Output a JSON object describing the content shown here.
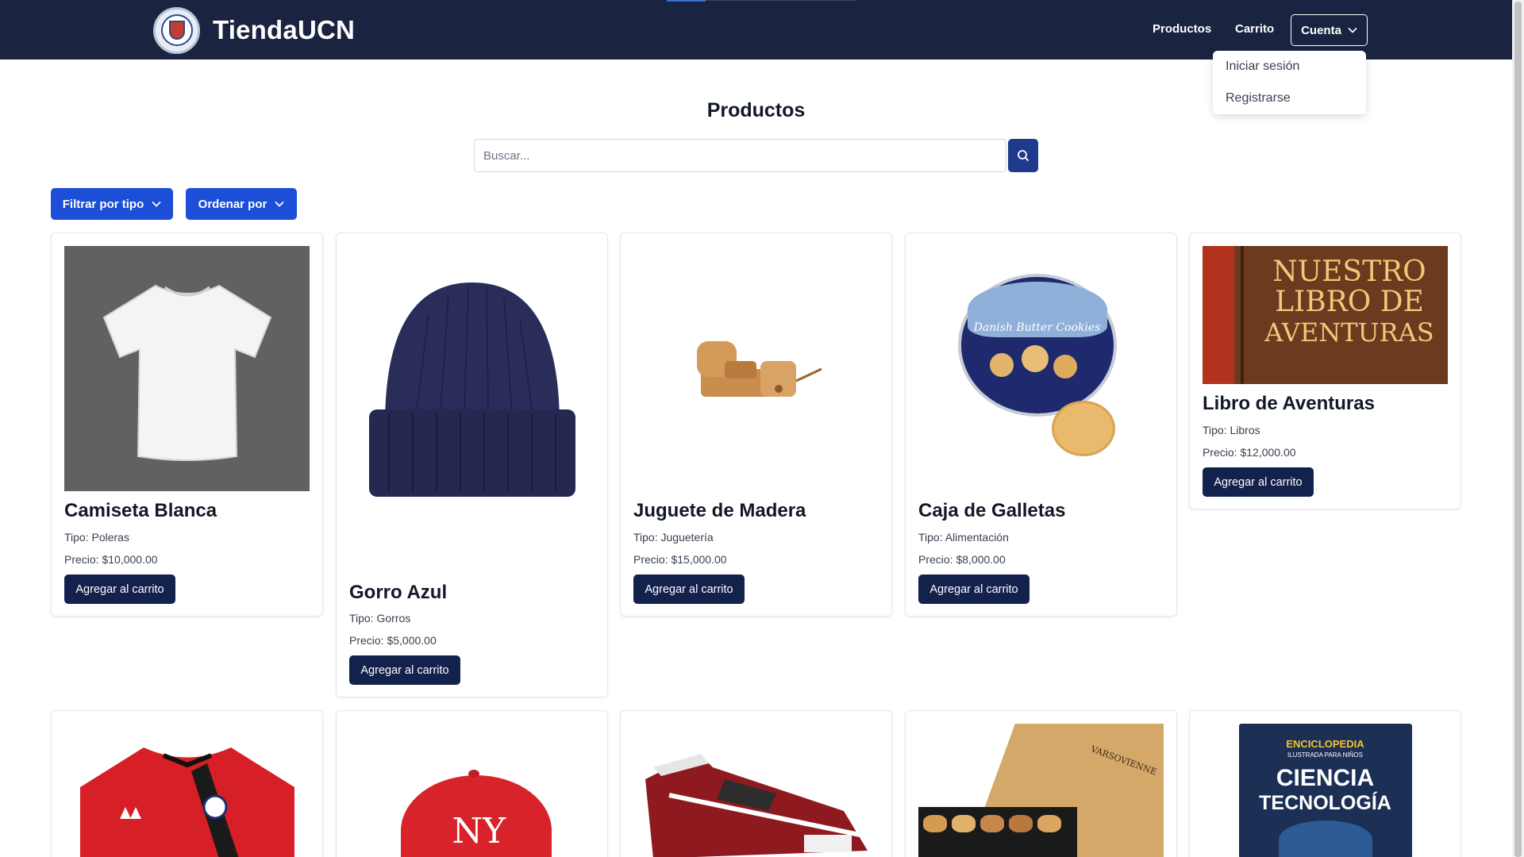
{
  "brand": {
    "name": "TiendaUCN"
  },
  "nav": {
    "products": "Productos",
    "cart": "Carrito",
    "account": "Cuenta"
  },
  "account_menu": {
    "login": "Iniciar sesión",
    "register": "Registrarse"
  },
  "page": {
    "title": "Productos"
  },
  "search": {
    "placeholder": "Buscar..."
  },
  "filters": {
    "by_type": "Filtrar por tipo",
    "order_by": "Ordenar por"
  },
  "products": [
    {
      "name": "Camiseta Blanca",
      "type": "Tipo: Poleras",
      "price": "Precio: $10,000.00",
      "button": "Agregar al carrito"
    },
    {
      "name": "Gorro Azul",
      "type": "Tipo: Gorros",
      "price": "Precio: $5,000.00",
      "button": "Agregar al carrito"
    },
    {
      "name": "Juguete de Madera",
      "type": "Tipo: Juguetería",
      "price": "Precio: $15,000.00",
      "button": "Agregar al carrito"
    },
    {
      "name": "Caja de Galletas",
      "type": "Tipo: Alimentación",
      "price": "Precio: $8,000.00",
      "button": "Agregar al carrito"
    },
    {
      "name": "Libro de Aventuras",
      "type": "Tipo: Libros",
      "price": "Precio: $12,000.00",
      "button": "Agregar al carrito"
    }
  ],
  "image_text": {
    "cookies": "Danish Butter Cookies",
    "book_line1": "NUESTRO",
    "book_line2": "LIBRO DE",
    "book_line3": "AVENTURAS",
    "cap_logo": "NY",
    "encyclopedia_top": "ENCICLOPEDIA",
    "encyclopedia_sub": "ILUSTRADA PARA NIÑOS",
    "encyclopedia_title1": "CIENCIA",
    "encyclopedia_title2": "TECNOLOGÍA",
    "chocolate_brand": "VARSOVIENNE"
  }
}
